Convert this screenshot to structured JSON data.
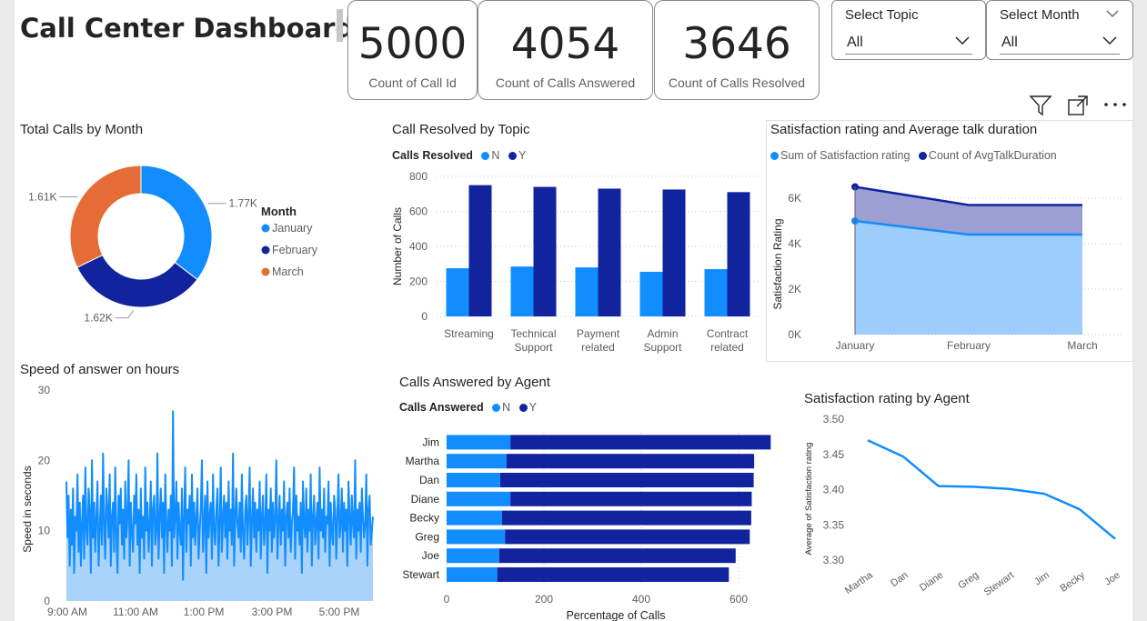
{
  "header": {
    "title": "Call Center Dashboard"
  },
  "kpis": [
    {
      "value": "5000",
      "label": "Count of Call Id"
    },
    {
      "value": "4054",
      "label": "Count of Calls Answered"
    },
    {
      "value": "3646",
      "label": "Count of Calls Resolved"
    }
  ],
  "slicers": [
    {
      "title": "Select Topic",
      "value": "All"
    },
    {
      "title": "Select Month",
      "value": "All"
    }
  ],
  "colors": {
    "light": "#118dff",
    "dark": "#12239e",
    "orange": "#e66c37",
    "area_light": "#9ccdfc",
    "area_dark": "#9b9fd3",
    "speed_fill": "#a9d3fb"
  },
  "chart_data": [
    {
      "id": "donut",
      "type": "pie",
      "title": "Total Calls by Month",
      "legend_title": "Month",
      "categories": [
        "January",
        "February",
        "March"
      ],
      "values": [
        1770,
        1620,
        1610
      ],
      "labels": [
        "1.77K",
        "1.62K",
        "1.61K"
      ]
    },
    {
      "id": "resolved",
      "type": "bar",
      "title": "Call Resolved by Topic",
      "legend_title": "Calls Resolved",
      "categories": [
        "Streaming",
        "Technical Support",
        "Payment related",
        "Admin Support",
        "Contract related"
      ],
      "series": [
        {
          "name": "N",
          "values": [
            275,
            285,
            280,
            255,
            270
          ]
        },
        {
          "name": "Y",
          "values": [
            750,
            740,
            730,
            725,
            710
          ]
        }
      ],
      "ylabel": "Number of Calls",
      "ylim": [
        0,
        800
      ],
      "yticks": [
        "0",
        "200",
        "400",
        "600",
        "800"
      ]
    },
    {
      "id": "satisfaction",
      "type": "area",
      "title": "Satisfaction rating and Average talk duration",
      "categories": [
        "January",
        "February",
        "March"
      ],
      "series": [
        {
          "name": "Sum of Satisfaction rating",
          "values": [
            5000,
            4400,
            4400
          ]
        },
        {
          "name": "Count of AvgTalkDuration",
          "values": [
            6500,
            5700,
            5700
          ]
        }
      ],
      "ylabel": "Satisfaction Rating",
      "ylim": [
        0,
        7000
      ],
      "yticks": [
        "0K",
        "2K",
        "4K",
        "6K"
      ]
    },
    {
      "id": "speed",
      "type": "area",
      "title": "Speed of answer on hours",
      "ylabel": "Speed in seconds",
      "ylim": [
        0,
        30
      ],
      "yticks": [
        "0",
        "10",
        "20",
        "30"
      ],
      "xticks": [
        "9:00 AM",
        "11:00 AM",
        "1:00 PM",
        "3:00 PM",
        "5:00 PM"
      ],
      "values": [
        17,
        9,
        15,
        5,
        13,
        8,
        16,
        4,
        12,
        10,
        18,
        7,
        14,
        5,
        11,
        15,
        6,
        19,
        10,
        8,
        16,
        13,
        4,
        20,
        9,
        14,
        7,
        12,
        17,
        5,
        10,
        15,
        8,
        21,
        11,
        6,
        16,
        13,
        9,
        18,
        5,
        12,
        14,
        7,
        19,
        10,
        4,
        15,
        11,
        16,
        8,
        13,
        6,
        17,
        9,
        12,
        20,
        5,
        14,
        10,
        7,
        15,
        11,
        18,
        8,
        13,
        4,
        16,
        9,
        12,
        6,
        19,
        10,
        14,
        7,
        11,
        17,
        5,
        13,
        15,
        8,
        10,
        21,
        6,
        12,
        16,
        9,
        14,
        4,
        18,
        11,
        7,
        13,
        10,
        15,
        5,
        27,
        9,
        12,
        17,
        6,
        14,
        10,
        8,
        16,
        3,
        12,
        19,
        7,
        13,
        11,
        15,
        5,
        18,
        9,
        14,
        8,
        12,
        16,
        6,
        10,
        13,
        20,
        7,
        11,
        15,
        4,
        17,
        9,
        12,
        14,
        6,
        18,
        10,
        8,
        13,
        16,
        5,
        11,
        19,
        7,
        12,
        15,
        9,
        14,
        6,
        17,
        10,
        13,
        8,
        21,
        5,
        12,
        16,
        11,
        9,
        14,
        7,
        18,
        10,
        6,
        13,
        15,
        8,
        12,
        19,
        5,
        11,
        16,
        9,
        14,
        7,
        13,
        10,
        17,
        6,
        12,
        15,
        8,
        11,
        18,
        4,
        13,
        10,
        16,
        7,
        14,
        9,
        12,
        20,
        6,
        11,
        15,
        8,
        13,
        10,
        17,
        5,
        12,
        14,
        9,
        16,
        7,
        11,
        13,
        19,
        6,
        15,
        10,
        12,
        8,
        14,
        4,
        17,
        11,
        9,
        16,
        7,
        13,
        10,
        18,
        5,
        12,
        15,
        8,
        11,
        14,
        6,
        19,
        10,
        13,
        9,
        16,
        7,
        12,
        11,
        17,
        5,
        14,
        10,
        8,
        15,
        13,
        6,
        12,
        18,
        9,
        11,
        16,
        7,
        14,
        10,
        13,
        5,
        17,
        12,
        8,
        15,
        11,
        9,
        20,
        6,
        13,
        10,
        14,
        7,
        16,
        12,
        9,
        11,
        18,
        5,
        13,
        15,
        8,
        10,
        12
      ],
      "fill": "#a9d3fb"
    },
    {
      "id": "answered",
      "type": "bar",
      "title": "Calls Answered by Agent",
      "legend_title": "Calls Answered",
      "categories": [
        "Jim",
        "Martha",
        "Dan",
        "Diane",
        "Becky",
        "Greg",
        "Joe",
        "Stewart"
      ],
      "series": [
        {
          "name": "N",
          "values": [
            131,
            123,
            110,
            131,
            114,
            120,
            108,
            104
          ]
        },
        {
          "name": "Y",
          "values": [
            535,
            509,
            521,
            496,
            512,
            503,
            486,
            476
          ]
        }
      ],
      "xlabel": "Percentage of Calls",
      "xlim": [
        0,
        650
      ],
      "xticks": [
        "0",
        "200",
        "400",
        "600"
      ]
    },
    {
      "id": "agent_rating",
      "type": "line",
      "title": "Satisfaction rating by Agent",
      "categories": [
        "Martha",
        "Dan",
        "Diane",
        "Greg",
        "Stewart",
        "Jim",
        "Becky",
        "Joe"
      ],
      "values": [
        3.47,
        3.447,
        3.405,
        3.404,
        3.401,
        3.394,
        3.372,
        3.33
      ],
      "ylabel": "Average of Satisfaction rating",
      "ylim": [
        3.3,
        3.5
      ],
      "yticks": [
        "3.30",
        "3.35",
        "3.40",
        "3.45",
        "3.50"
      ]
    }
  ]
}
